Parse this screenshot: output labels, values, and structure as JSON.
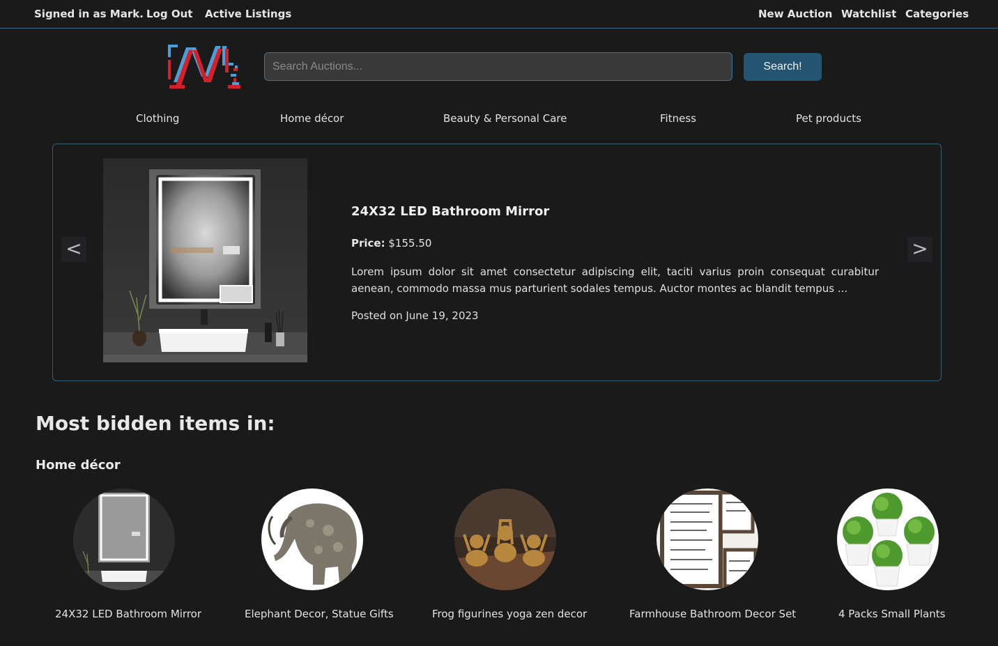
{
  "topnav": {
    "signed_in": "Signed in as Mark.",
    "logout": "Log Out",
    "active_listings": "Active Listings",
    "new_auction": "New Auction",
    "watchlist": "Watchlist",
    "categories": "Categories"
  },
  "search": {
    "placeholder": "Search Auctions...",
    "button": "Search!"
  },
  "categories": [
    "Clothing",
    "Home décor",
    "Beauty & Personal Care",
    "Fitness",
    "Pet products"
  ],
  "featured": {
    "title": "24X32 LED Bathroom Mirror",
    "price_label": "Price:",
    "price_value": "$155.50",
    "description": "Lorem ipsum dolor sit amet consectetur adipiscing elit, taciti varius proin consequat curabitur aenean, commodo massa mus parturient sodales tempus. Auctor montes ac blandit tempus ...",
    "posted": "Posted on June 19, 2023",
    "prev": "<",
    "next": ">"
  },
  "most_bidden": {
    "heading": "Most bidden items in:",
    "category": "Home décor",
    "items": [
      {
        "label": "24X32 LED Bathroom Mirror"
      },
      {
        "label": "Elephant Decor, Statue Gifts"
      },
      {
        "label": "Frog figurines yoga zen decor"
      },
      {
        "label": "Farmhouse Bathroom Decor Set"
      },
      {
        "label": "4 Packs Small Plants"
      }
    ]
  },
  "colors": {
    "background": "#1a1a1b",
    "accent_border": "#3b6d86",
    "button": "#245470",
    "logo_red": "#d4202a",
    "logo_blue": "#4a9fd8"
  }
}
